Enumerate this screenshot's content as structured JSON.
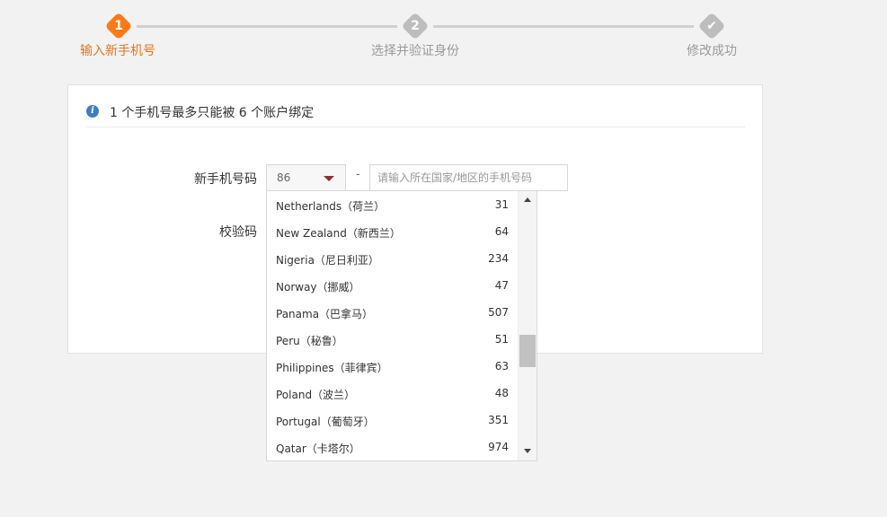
{
  "stepper": {
    "steps": [
      {
        "number": "1",
        "label": "输入新手机号"
      },
      {
        "number": "2",
        "label": "选择并验证身份"
      },
      {
        "number": "✔",
        "label": "修改成功"
      }
    ],
    "active_color": "#ff7a16",
    "inactive_color": "#bdbdbd"
  },
  "notice": {
    "icon": "info-icon",
    "text": "1 个手机号最多只能被 6 个账户绑定"
  },
  "form": {
    "phone_label": "新手机号码",
    "country_code_value": "86",
    "dash": "-",
    "phone_placeholder": "请输入所在国家/地区的手机号码",
    "code_label": "校验码"
  },
  "dropdown": {
    "options": [
      {
        "name": "Netherlands（荷兰）",
        "code": "31"
      },
      {
        "name": "New Zealand（新西兰）",
        "code": "64"
      },
      {
        "name": "Nigeria（尼日利亚）",
        "code": "234"
      },
      {
        "name": "Norway（挪威）",
        "code": "47"
      },
      {
        "name": "Panama（巴拿马）",
        "code": "507"
      },
      {
        "name": "Peru（秘鲁）",
        "code": "51"
      },
      {
        "name": "Philippines（菲律宾）",
        "code": "63"
      },
      {
        "name": "Poland（波兰）",
        "code": "48"
      },
      {
        "name": "Portugal（葡萄牙）",
        "code": "351"
      },
      {
        "name": "Qatar（卡塔尔）",
        "code": "974"
      }
    ]
  }
}
